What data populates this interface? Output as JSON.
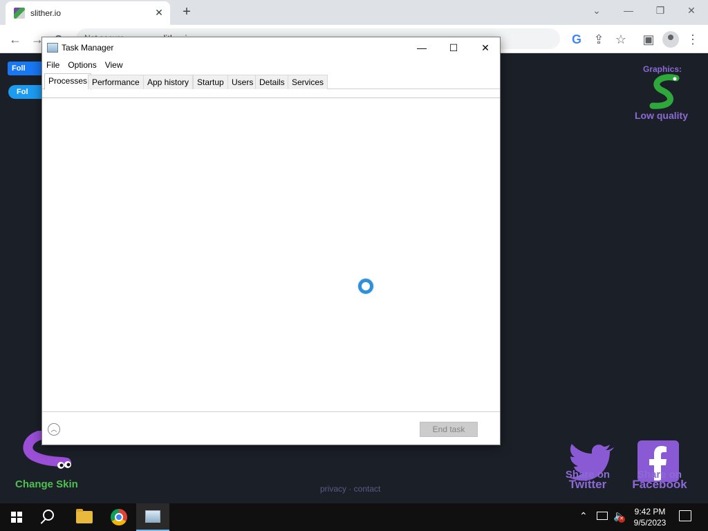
{
  "browser": {
    "tab_title": "slither.io",
    "tab_close": "✕",
    "new_tab": "+",
    "window_controls": {
      "chevron": "⌄",
      "minimize": "—",
      "restore": "❐",
      "close": "✕"
    },
    "toolbar": {
      "back": "←",
      "forward": "→",
      "reload": "⟳",
      "secure_text": "Not secure",
      "url": "slither.io",
      "google": "G",
      "share": "⇪",
      "star": "☆",
      "side_panel": "▣",
      "menu": "⋮"
    }
  },
  "page": {
    "fb_follow": "Foll",
    "tw_follow": "Fol",
    "graphics_label": "Graphics:",
    "graphics_quality": "Low quality",
    "change_skin": "Change Skin",
    "footer": "privacy · contact",
    "share_twitter": [
      "Share on",
      "Twitter"
    ],
    "share_facebook": [
      "Share on",
      "Facebook"
    ]
  },
  "task_manager": {
    "title": "Task Manager",
    "controls": {
      "minimize": "—",
      "maximize": "☐",
      "close": "✕"
    },
    "menu": [
      "File",
      "Options",
      "View"
    ],
    "tabs": [
      "Processes",
      "Performance",
      "App history",
      "Startup",
      "Users",
      "Details",
      "Services"
    ],
    "active_tab": "Processes",
    "fewer_details_icon": "chevron-up-icon",
    "end_task": "End task"
  },
  "taskbar": {
    "apps": [
      "start",
      "search",
      "file-explorer",
      "chrome",
      "task-manager"
    ],
    "tray_up": "⌃",
    "clock_time": "9:42 PM",
    "clock_date": "9/5/2023"
  },
  "colors": {
    "page_bg": "#1b2028",
    "accent": "#2f8fd8",
    "slither_purple": "#8c6ad4",
    "slither_green": "#4fc04f"
  }
}
